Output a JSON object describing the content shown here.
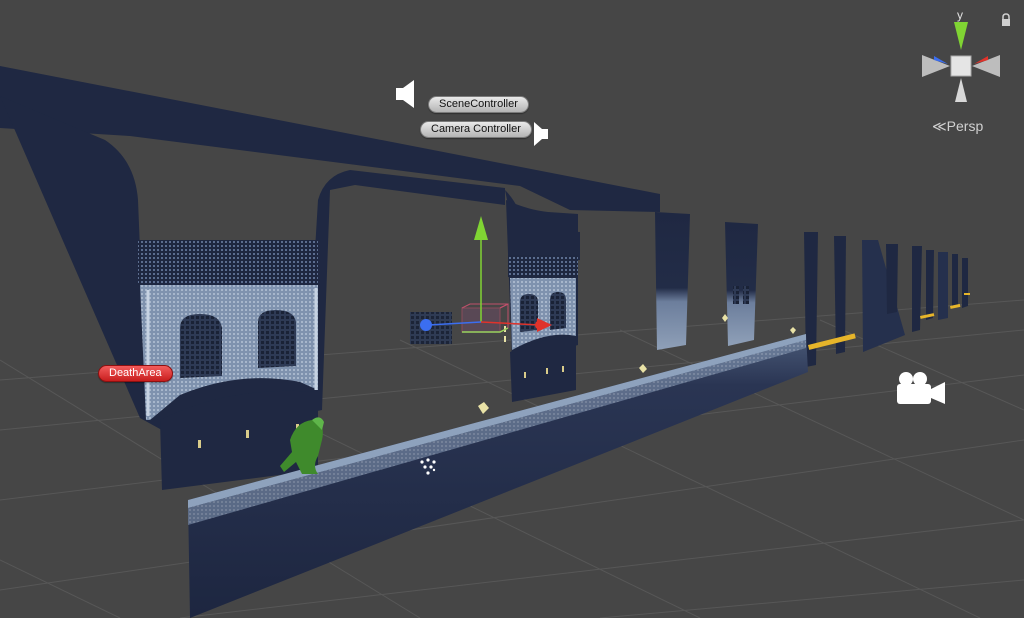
{
  "labels": {
    "scene_controller": "SceneController",
    "camera_controller": "Camera Controller",
    "death_area": "DeathArea"
  },
  "orientation": {
    "axis_y": "y",
    "projection": "Persp",
    "projection_icon": "chevron-left-icon",
    "lock_icon": "lock-icon"
  },
  "icons": {
    "scene_speaker": "speaker-icon",
    "camera_speaker": "speaker-icon",
    "camera": "camera-icon",
    "particles": "particle-system-icon"
  },
  "colors": {
    "background": "#464646",
    "grid": "#5a5a5a",
    "wall_dark": "#1e2740",
    "wall_light": "#8fa0b8",
    "axis_x": "#e0332b",
    "axis_y": "#80d433",
    "axis_z": "#3b6ef0",
    "death_tag": "#d63030",
    "tag_gray": "#d0d0d0",
    "highlight": "#e7b52a"
  }
}
